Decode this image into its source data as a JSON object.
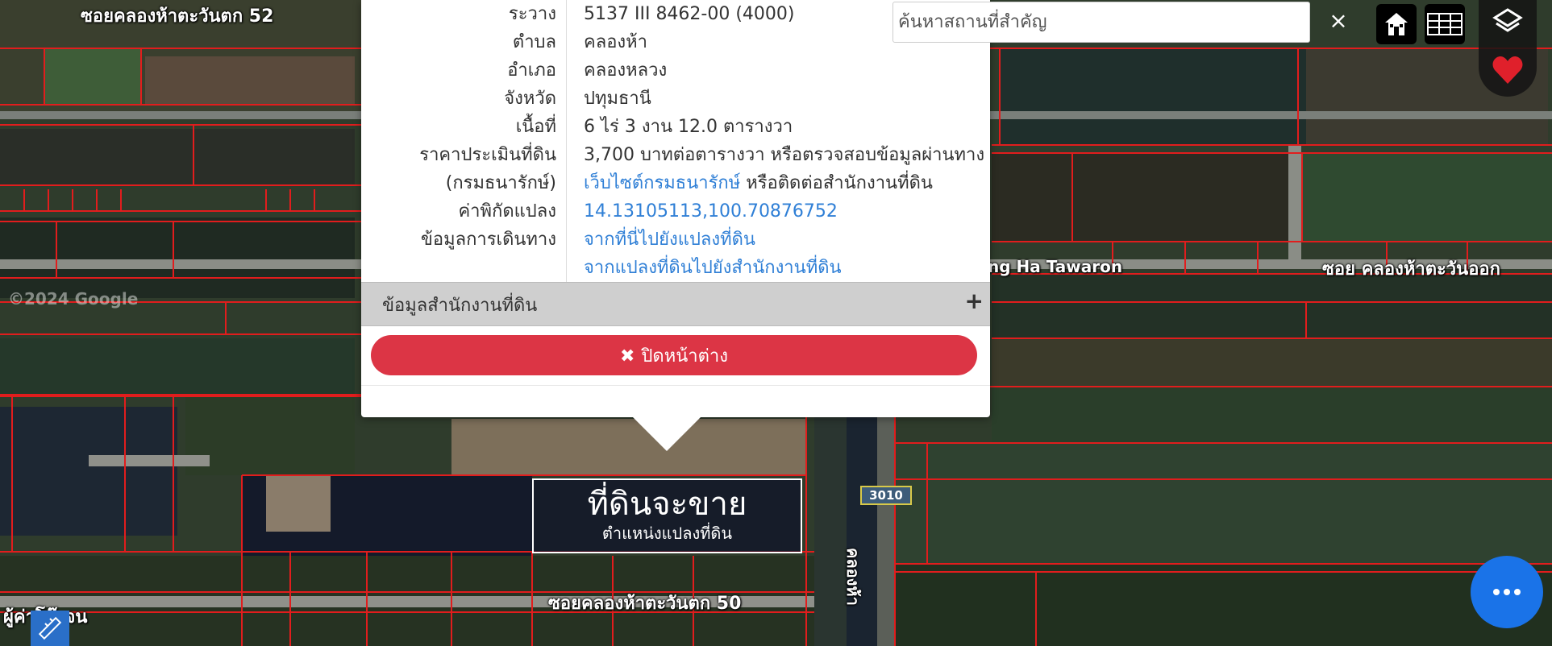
{
  "colors": {
    "accent": "#2f7fd6",
    "danger": "#dc3545",
    "plot_line": "#e11d1d",
    "fab": "#1a73e8",
    "heart": "#e0202b"
  },
  "map": {
    "labels": {
      "road_52": "ซอยคลองห้าตะวันตก 52",
      "road_50": "ซอยคลองห้าตะวันตก 50",
      "road_east": "ซอย คลองห้าตะวันออก",
      "road_ha": "ng Ha Tawaron",
      "canal": "คลองห้า",
      "bottom_left": "ผู้ค่าโจ๊ะจน",
      "copyright": "©2024 Google"
    },
    "route_badge": "3010",
    "marker": {
      "title": "ที่ดินจะขาย",
      "subtitle": "ตำแหน่งแปลงที่ดิน"
    }
  },
  "popup": {
    "rows": [
      {
        "label": "ระวาง",
        "value": "5137 III 8462-00 (4000)"
      },
      {
        "label": "ตำบล",
        "value": "คลองห้า"
      },
      {
        "label": "อำเภอ",
        "value": "คลองหลวง"
      },
      {
        "label": "จังหวัด",
        "value": "ปทุมธานี"
      },
      {
        "label": "เนื้อที่",
        "value": "6 ไร่ 3 งาน 12.0 ตารางวา"
      },
      {
        "label": "ราคาประเมินที่ดิน",
        "value": "3,700 บาทต่อตารางวา หรือตรวจสอบข้อมูลผ่านทาง"
      },
      {
        "label": "(กรมธนารักษ์)",
        "link": "เว็บไซต์กรมธนารักษ์",
        "value_suffix": " หรือติดต่อสำนักงานที่ดิน"
      },
      {
        "label": "ค่าพิกัดแปลง",
        "link": "14.13105113,100.70876752"
      },
      {
        "label": "ข้อมูลการเดินทาง",
        "link": "จากที่นี่ไปยังแปลงที่ดิน"
      },
      {
        "label": "",
        "link": "จากแปลงที่ดินไปยังสำนักงานที่ดิน"
      }
    ],
    "office_panel_label": "ข้อมูลสำนักงานที่ดิน",
    "office_panel_toggle": "+",
    "close_button_label": "ปิดหน้าต่าง"
  },
  "search": {
    "placeholder": "ค้นหาสถานที่สำคัญ",
    "value": "",
    "clear_label": "×"
  },
  "icons": {
    "home": "home-icon",
    "grid": "grid-icon",
    "layers": "layers-icon",
    "favorite": "heart-icon",
    "more": "more-icon",
    "draw": "ruler-icon"
  }
}
